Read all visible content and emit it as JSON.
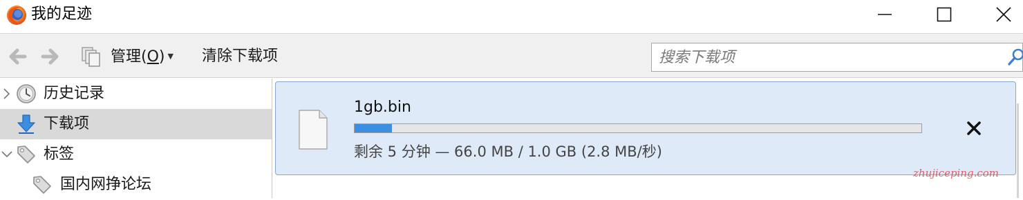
{
  "window": {
    "title": "我的足迹",
    "icon": "firefox-icon"
  },
  "toolbar": {
    "organize_prefix": "管理(",
    "organize_key": "O",
    "organize_suffix": ")",
    "clear_downloads": "清除下载项",
    "search_placeholder": "搜索下载项"
  },
  "sidebar": {
    "items": [
      {
        "label": "历史记录",
        "icon": "clock-icon",
        "expandable": true,
        "expanded": false,
        "selected": false
      },
      {
        "label": "下载项",
        "icon": "download-arrow-icon",
        "expandable": false,
        "selected": true
      },
      {
        "label": "标签",
        "icon": "tag-icon",
        "expandable": true,
        "expanded": true,
        "selected": false
      },
      {
        "label": "国内网挣论坛",
        "icon": "tag-icon",
        "expandable": false,
        "selected": false
      }
    ]
  },
  "downloads": [
    {
      "filename": "1gb.bin",
      "progress": 0.066,
      "status": "剩余 5 分钟 — 66.0 MB / 1.0 GB (2.8 MB/秒)"
    }
  ],
  "watermark": "zhujiceping.com",
  "colors": {
    "accent": "#3c8ee3",
    "selected_row": "#d9d9d9",
    "download_item_bg": "#dfeaf8",
    "download_item_border": "#86a8d8",
    "watermark": "#e0474f"
  }
}
